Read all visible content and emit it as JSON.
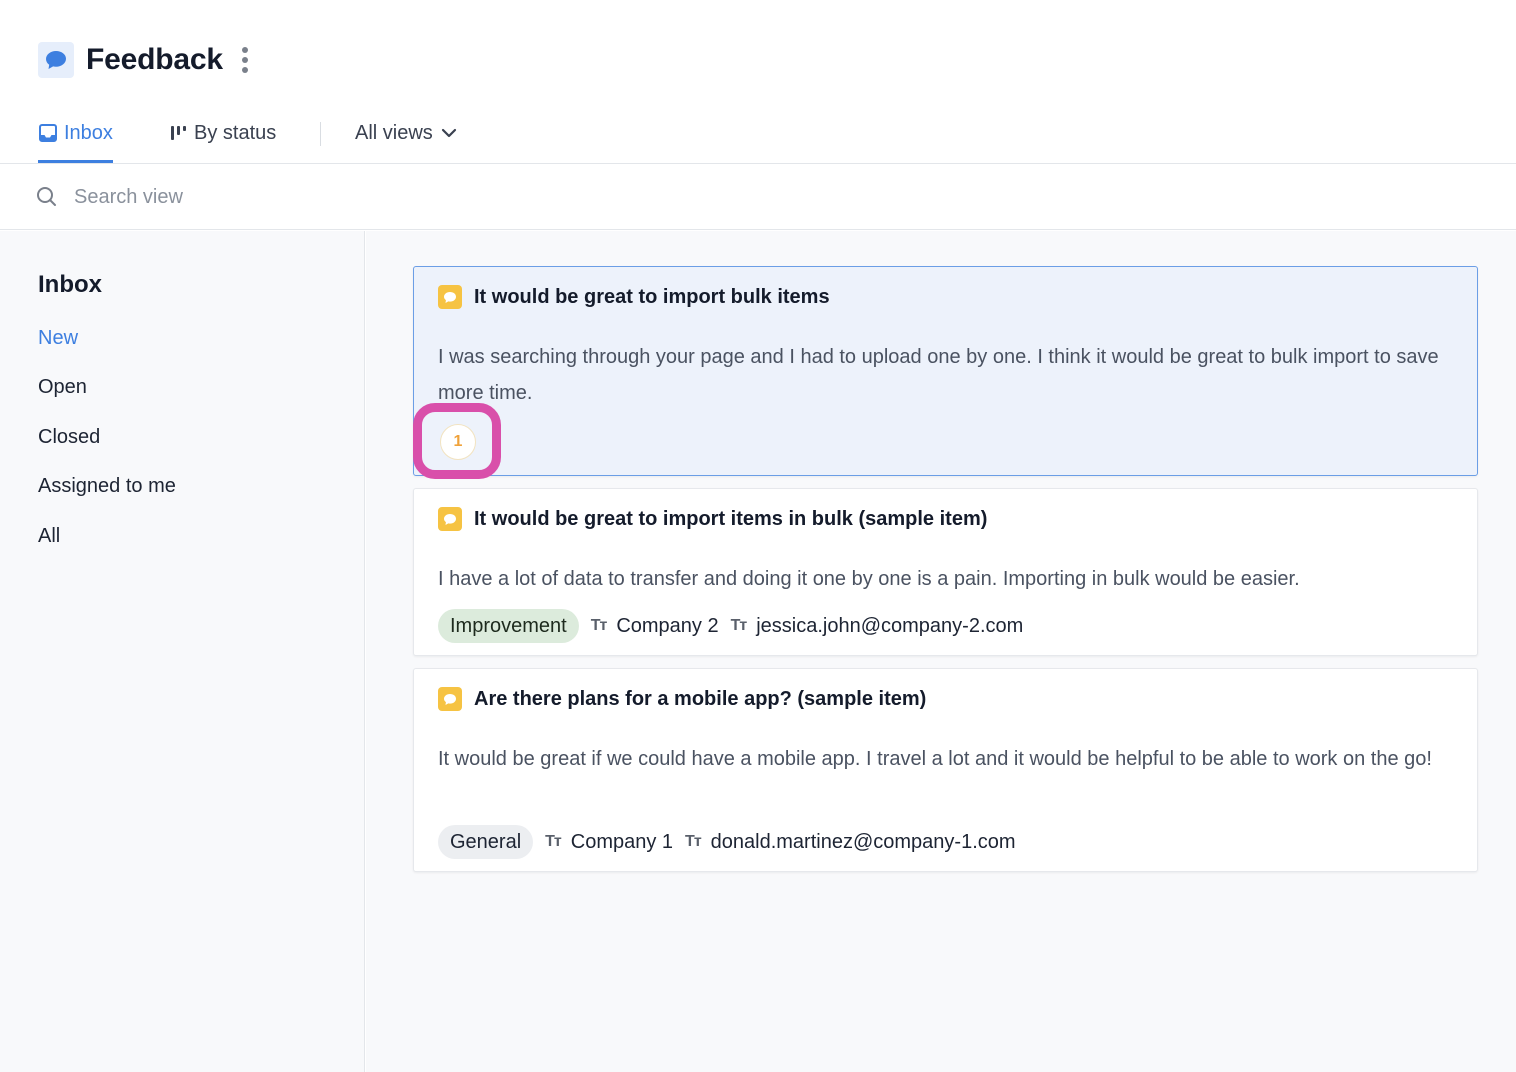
{
  "header": {
    "title": "Feedback",
    "app_icon": "speech-bubble-icon",
    "accent": "#3d7fe0"
  },
  "tabs": [
    {
      "label": "Inbox",
      "icon": "inbox-icon",
      "active": true
    },
    {
      "label": "By status",
      "icon": "status-columns-icon",
      "active": false
    },
    {
      "label": "All views",
      "icon": "chevron-down-icon",
      "active": false
    }
  ],
  "search": {
    "placeholder": "Search view",
    "value": ""
  },
  "sidebar": {
    "heading": "Inbox",
    "items": [
      {
        "label": "New",
        "active": true
      },
      {
        "label": "Open",
        "active": false
      },
      {
        "label": "Closed",
        "active": false
      },
      {
        "label": "Assigned to me",
        "active": false
      },
      {
        "label": "All",
        "active": false
      }
    ]
  },
  "cards": [
    {
      "title": "It would be great to import bulk items",
      "body": "I was searching through your page and I had to upload one by one. I think it would be great to bulk import to save more time.",
      "votes": "1",
      "selected": true
    },
    {
      "title": "It would be great to import items in bulk (sample item)",
      "body": "I have a lot of data to transfer and doing it one by one is a pain. Importing in bulk would be easier.",
      "tag": "Improvement",
      "company": "Company 2",
      "email": "jessica.john@company-2.com",
      "tt_glyph": "Tт"
    },
    {
      "title": "Are there plans for a mobile app? (sample item)",
      "body": "It would be great if we could have a mobile app. I travel a lot and it would be helpful to be able to work on the go!",
      "tag": "General",
      "company": "Company 1",
      "email": "donald.martinez@company-1.com",
      "tt_glyph": "Tт"
    }
  ],
  "colors": {
    "highlight": "#d94faa",
    "feedback_icon": "#f6c343",
    "tag_improvement": "#dcebdc",
    "tag_general": "#eceef1"
  }
}
